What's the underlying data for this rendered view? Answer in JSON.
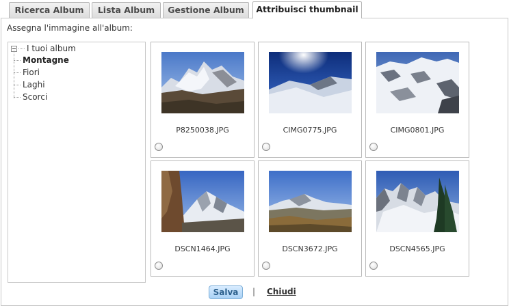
{
  "tabs": [
    {
      "label": "Ricerca Album"
    },
    {
      "label": "Lista Album"
    },
    {
      "label": "Gestione Album"
    },
    {
      "label": "Attribuisci thumbnail"
    }
  ],
  "assign_label": "Assegna l'immagine all'album:",
  "tree": {
    "root_label": "I tuoi album",
    "items": [
      {
        "label": "Montagne",
        "selected": true
      },
      {
        "label": "Fiori"
      },
      {
        "label": "Laghi"
      },
      {
        "label": "Scorci"
      }
    ]
  },
  "thumbnails": [
    {
      "filename": "P8250038.JPG"
    },
    {
      "filename": "CIMG0775.JPG"
    },
    {
      "filename": "CIMG0801.JPG"
    },
    {
      "filename": "DSCN1464.JPG"
    },
    {
      "filename": "DSCN3672.JPG"
    },
    {
      "filename": "DSCN4565.JPG"
    }
  ],
  "footer": {
    "save_label": "Salva",
    "separator": "|",
    "close_label": "Chiudi"
  }
}
